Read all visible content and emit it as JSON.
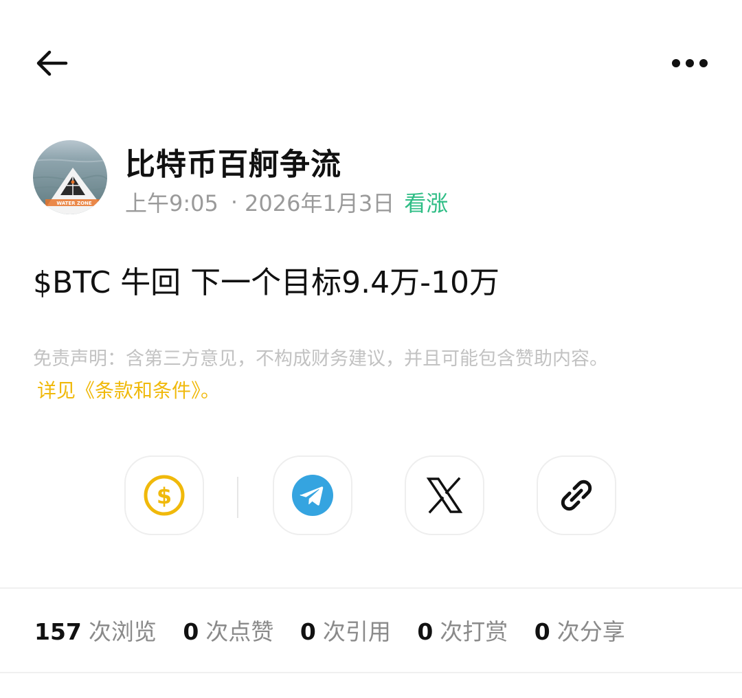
{
  "header": {
    "back_icon": "arrow-left-icon",
    "more_icon": "more-horizontal-icon"
  },
  "author": {
    "name": "比特币百舸争流",
    "avatar_caption": "WATER ZONE",
    "time": "上午9:05",
    "separator": "·",
    "date": "2026年1月3日",
    "sentiment": "看涨",
    "sentiment_color": "#2ebd85"
  },
  "post": {
    "content": "$BTC 牛回 下一个目标9.4万-10万"
  },
  "disclaimer": {
    "text": "免责声明：含第三方意见，不构成财务建议，并且可能包含赞助内容。",
    "link": "详见《条款和条件》。",
    "link_color": "#f0b90b"
  },
  "share": {
    "items": [
      {
        "name": "tip",
        "icon": "dollar-coin-icon"
      },
      {
        "name": "telegram",
        "icon": "telegram-icon"
      },
      {
        "name": "x",
        "icon": "x-logo-icon"
      },
      {
        "name": "copy-link",
        "icon": "link-icon"
      }
    ]
  },
  "stats": {
    "views_count": "157",
    "views_label": "次浏览",
    "likes_count": "0",
    "likes_label": "次点赞",
    "quotes_count": "0",
    "quotes_label": "次引用",
    "tips_count": "0",
    "tips_label": "次打赏",
    "shares_count": "0",
    "shares_label": "次分享"
  }
}
